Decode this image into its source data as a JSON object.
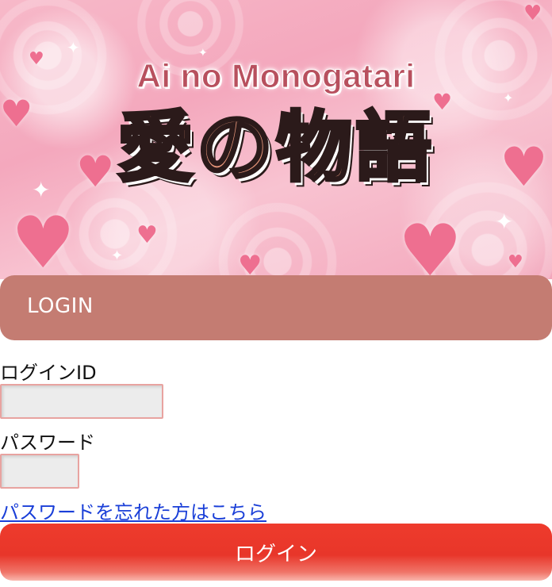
{
  "banner": {
    "subtitle": "Ai no Monogatari",
    "title": "愛の物語",
    "heart_icon": "heart-icon",
    "sparkle_icon": "sparkle-icon",
    "background_color": "#f4a8bd",
    "heart_color": "#ee6f90"
  },
  "login_header": {
    "label": "LOGIN",
    "color": "#c47c72"
  },
  "form": {
    "login_id_label": "ログインID",
    "login_id_value": "",
    "password_label": "パスワード",
    "password_value": "",
    "forgot_password_link": "パスワードを忘れた方はこちら",
    "input_border_color": "#e8a3a0"
  },
  "submit": {
    "label": "ログイン",
    "color": "#e8362a"
  }
}
